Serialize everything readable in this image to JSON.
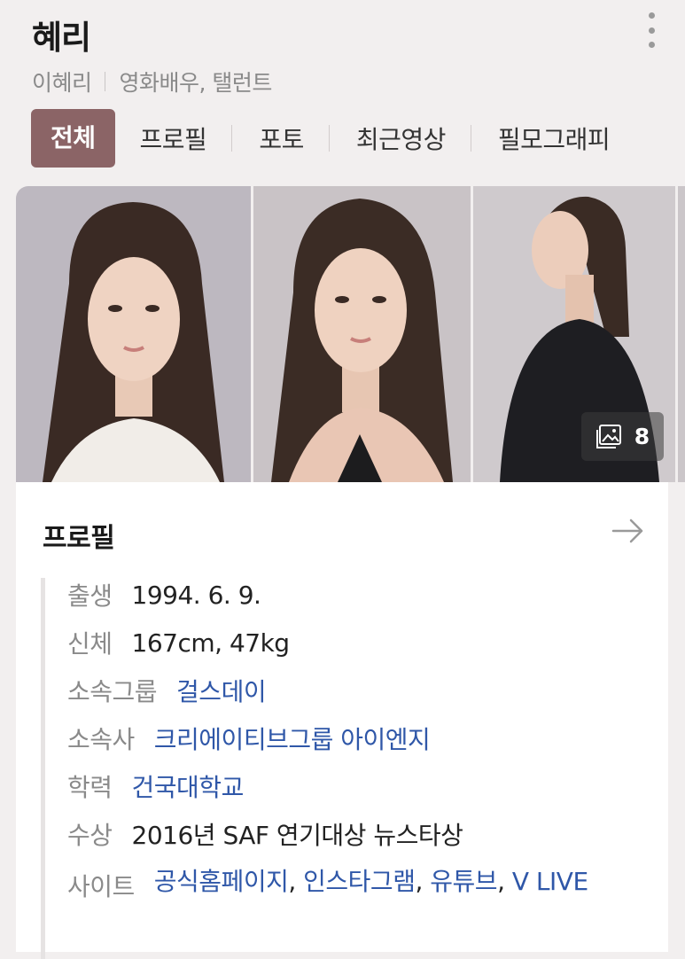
{
  "header": {
    "title": "혜리",
    "real_name": "이혜리",
    "occupation": "영화배우, 탤런트"
  },
  "tabs": [
    {
      "label": "전체",
      "active": true
    },
    {
      "label": "프로필",
      "active": false
    },
    {
      "label": "포토",
      "active": false
    },
    {
      "label": "최근영상",
      "active": false
    },
    {
      "label": "필모그래피",
      "active": false
    }
  ],
  "photos": {
    "count": "8",
    "icon": "image-gallery-icon"
  },
  "profile": {
    "title": "프로필",
    "rows": [
      {
        "label": "출생",
        "value": "1994. 6. 9."
      },
      {
        "label": "신체",
        "value": "167cm, 47kg"
      },
      {
        "label": "소속그룹",
        "links": [
          "걸스데이"
        ]
      },
      {
        "label": "소속사",
        "links": [
          "크리에이티브그룹 아이엔지"
        ]
      },
      {
        "label": "학력",
        "links": [
          "건국대학교"
        ]
      },
      {
        "label": "수상",
        "value": "2016년 SAF 연기대상 뉴스타상"
      },
      {
        "label": "사이트",
        "links": [
          "공식홈페이지",
          "인스타그램",
          "유튜브",
          "V LIVE"
        ]
      }
    ]
  },
  "colors": {
    "active_tab": "#8b6466",
    "link": "#2f57a8",
    "background": "#f2efef"
  }
}
